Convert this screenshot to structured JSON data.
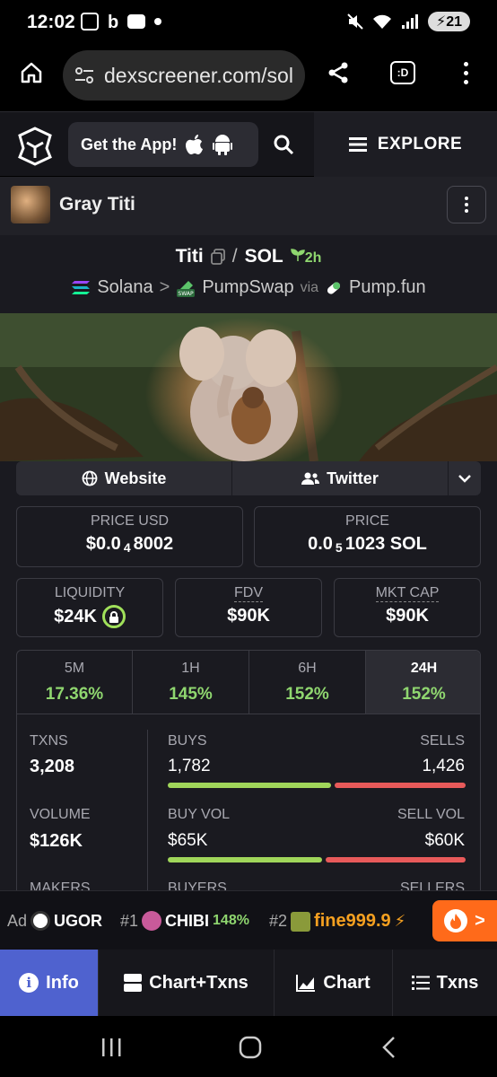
{
  "status_bar": {
    "time": "12:02",
    "battery": "21"
  },
  "browser": {
    "url": "dexscreener.com/sol"
  },
  "header": {
    "get_app_label": "Get the App!",
    "explore_label": "EXPLORE"
  },
  "token": {
    "name": "Gray Titi"
  },
  "pair": {
    "base": "Titi",
    "separator": "/",
    "quote": "SOL",
    "age": "2h",
    "chain": "Solana",
    "chevron": ">",
    "dex": "PumpSwap",
    "via": "via",
    "launchpad": "Pump.fun"
  },
  "links": {
    "website": "Website",
    "twitter": "Twitter"
  },
  "price": {
    "usd_label": "PRICE USD",
    "usd_prefix": "$0.0",
    "usd_sub": "4",
    "usd_suffix": "8002",
    "native_label": "PRICE",
    "native_prefix": "0.0",
    "native_sub": "5",
    "native_suffix": "1023 SOL"
  },
  "metrics": {
    "liquidity_label": "LIQUIDITY",
    "liquidity_value": "$24K",
    "fdv_label": "FDV",
    "fdv_value": "$90K",
    "mktcap_label": "MKT CAP",
    "mktcap_value": "$90K"
  },
  "periods": [
    {
      "label": "5M",
      "value": "17.36%"
    },
    {
      "label": "1H",
      "value": "145%"
    },
    {
      "label": "6H",
      "value": "152%"
    },
    {
      "label": "24H",
      "value": "152%",
      "selected": true
    }
  ],
  "stats": {
    "txns_label": "TXNS",
    "txns_value": "3,208",
    "buys_label": "BUYS",
    "buys_value": "1,782",
    "sells_label": "SELLS",
    "sells_value": "1,426",
    "volume_label": "VOLUME",
    "volume_value": "$126K",
    "buyvol_label": "BUY VOL",
    "buyvol_value": "$65K",
    "sellvol_label": "SELL VOL",
    "sellvol_value": "$60K",
    "makers_label": "MAKERS",
    "buyers_label": "BUYERS",
    "sellers_label": "SELLERS"
  },
  "ticker": {
    "ad_label": "Ad",
    "ad_name": "UGOR",
    "item1_rank": "#1",
    "item1_name": "CHIBI",
    "item1_change": "148%",
    "item2_rank": "#2",
    "item2_name": "fine999.9",
    "fire_arrow": ">"
  },
  "tabs": {
    "info": "Info",
    "chart_txns": "Chart+Txns",
    "chart": "Chart",
    "txns": "Txns"
  },
  "colors": {
    "green": "#8fd66f",
    "red": "#e85a5a",
    "buy_bar": "#a0d65a",
    "accent_tab": "#4f62cf",
    "fire": "#ff6a1a"
  }
}
